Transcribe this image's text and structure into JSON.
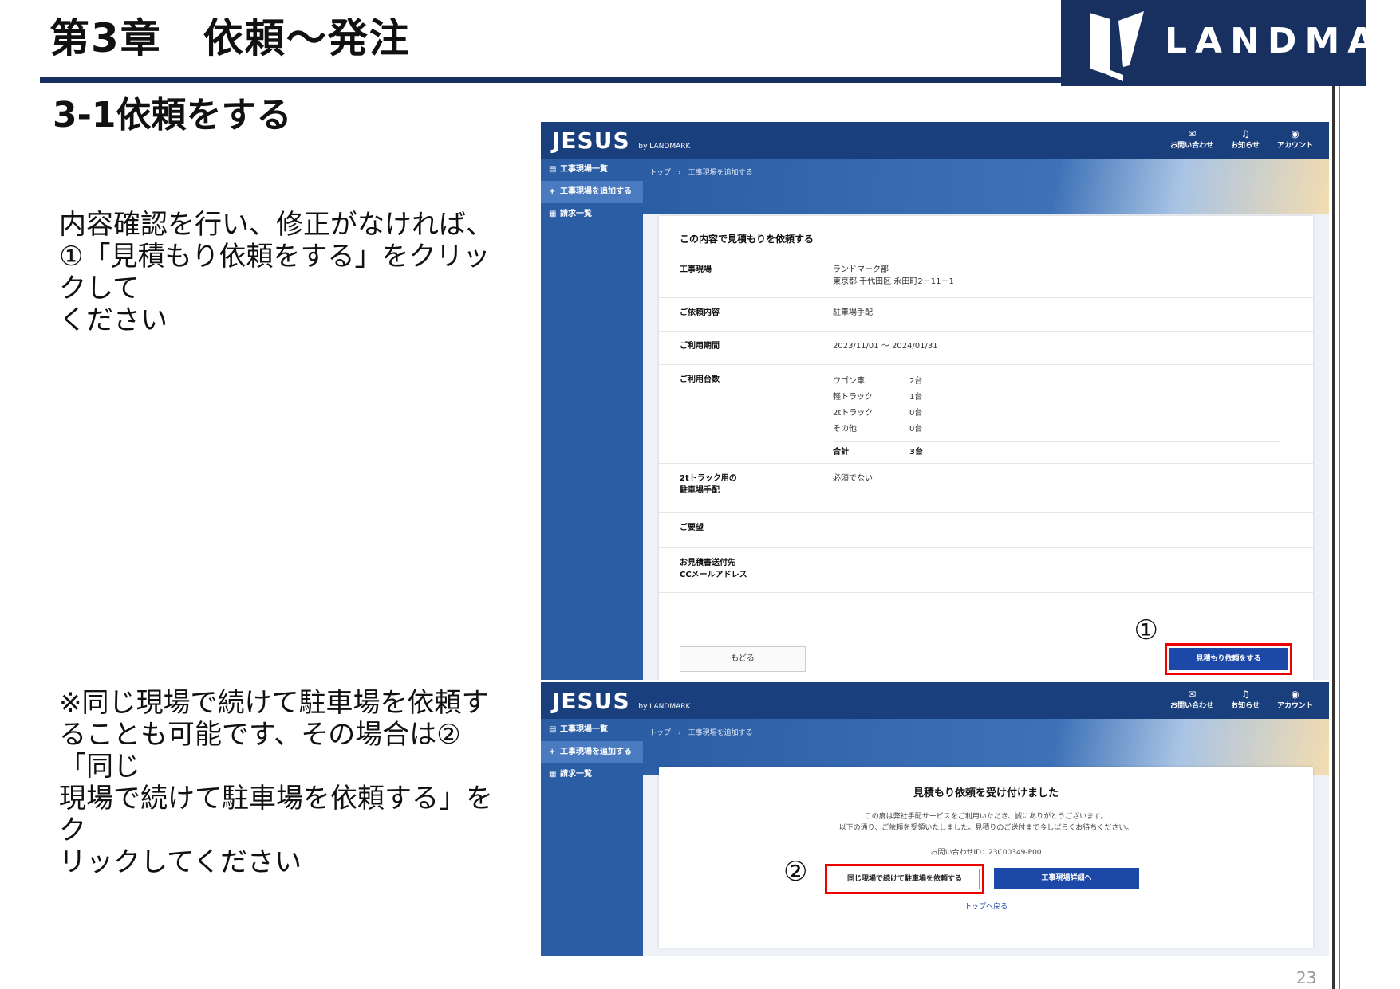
{
  "header": {
    "chapter_title": "第3章　依頼～発注",
    "logo_text": "LANDMARK"
  },
  "section_title": "3-1依頼をする",
  "instructions": {
    "line1": "内容確認を行い、修正がなければ、",
    "line2": "①「見積もり依頼をする」をクリックして",
    "line3": "ください",
    "note1": "※同じ現場で続けて駐車場を依頼す",
    "note2": "ることも可能です、その場合は②「同じ",
    "note3": "現場で続けて駐車場を依頼する」をク",
    "note4": "リックしてください"
  },
  "app": {
    "logo": "JESUS",
    "logo_sub": "by LANDMARK",
    "nav": [
      {
        "label": "お問い合わせ",
        "icon": "mail-icon"
      },
      {
        "label": "お知らせ",
        "icon": "bell-icon"
      },
      {
        "label": "アカウント",
        "icon": "account-icon"
      }
    ],
    "sidebar": [
      "工事現場一覧",
      "工事現場を追加する",
      "請求一覧"
    ],
    "breadcrumb": "トップ　›　工事現場を追加する"
  },
  "confirm": {
    "title": "この内容で見積もりを依頼する",
    "rows": [
      {
        "label": "工事現場",
        "value1": "ランドマーク部",
        "value2": "東京都 千代田区 永田町2－11－1"
      },
      {
        "label": "ご依頼内容",
        "value1": "駐車場手配"
      },
      {
        "label": "ご利用期間",
        "value1": "2023/11/01 ～ 2024/01/31"
      },
      {
        "label": "ご利用台数"
      },
      {
        "label1": "2tトラック用の",
        "label2": "駐車場手配",
        "value1": "必須でない"
      },
      {
        "label": "ご要望"
      },
      {
        "label1": "お見積書送付先",
        "label2": "CCメールアドレス"
      }
    ],
    "counts": [
      {
        "name": "ワゴン車",
        "num": "2台"
      },
      {
        "name": "軽トラック",
        "num": "1台"
      },
      {
        "name": "2tトラック",
        "num": "0台"
      },
      {
        "name": "その他",
        "num": "0台"
      }
    ],
    "total_label": "合計",
    "total_num": "3台",
    "back_label": "もどる",
    "request_label": "見積もり依頼をする",
    "marker": "①"
  },
  "done": {
    "title": "見積もり依頼を受け付けました",
    "msg1": "この度は弊社手配サービスをご利用いただき、誠にありがとうございます。",
    "msg2": "以下の通り、ご依頼を受領いたしました。見積りのご送付まで今しばらくお待ちください。",
    "inquiry_id": "お問い合わせID：23C00349-P00",
    "same_label": "同じ現場で続けて駐車場を依頼する",
    "detail_label": "工事現場詳細へ",
    "top_label": "トップへ戻る",
    "marker": "②"
  },
  "page_number": "23",
  "colors": {
    "navy": "#17305f",
    "app_blue": "#1a3f7d",
    "highlight": "#ee0000"
  }
}
